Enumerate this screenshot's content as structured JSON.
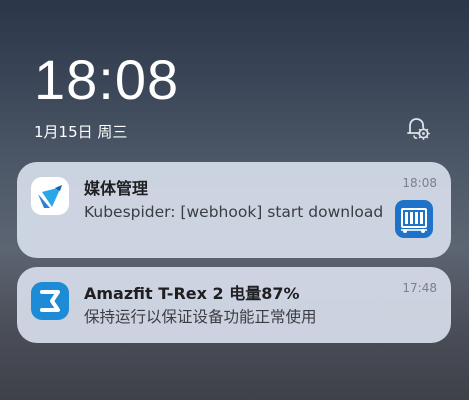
{
  "lockscreen": {
    "time": "18:08",
    "date": "1月15日 周三",
    "notification_settings_icon": "bell-gear-icon"
  },
  "notifications": [
    {
      "app_icon": "media-manager-bird-icon",
      "title": "媒体管理",
      "body": "Kubespider: [webhook] start download",
      "time": "18:08",
      "thumbnail_icon": "nas-server-icon"
    },
    {
      "app_icon": "zepp-icon",
      "title": "Amazfit T-Rex 2 电量87%",
      "body": "保持运行以保证设备功能正常使用",
      "time": "17:48"
    }
  ],
  "colors": {
    "card_background": "#d6dde9",
    "title_text": "#1f1f22",
    "body_text": "#3b3d44",
    "time_text": "#7c8089",
    "zepp_blue": "#1e8bd6",
    "thumbnail_blue": "#1e73c8"
  }
}
